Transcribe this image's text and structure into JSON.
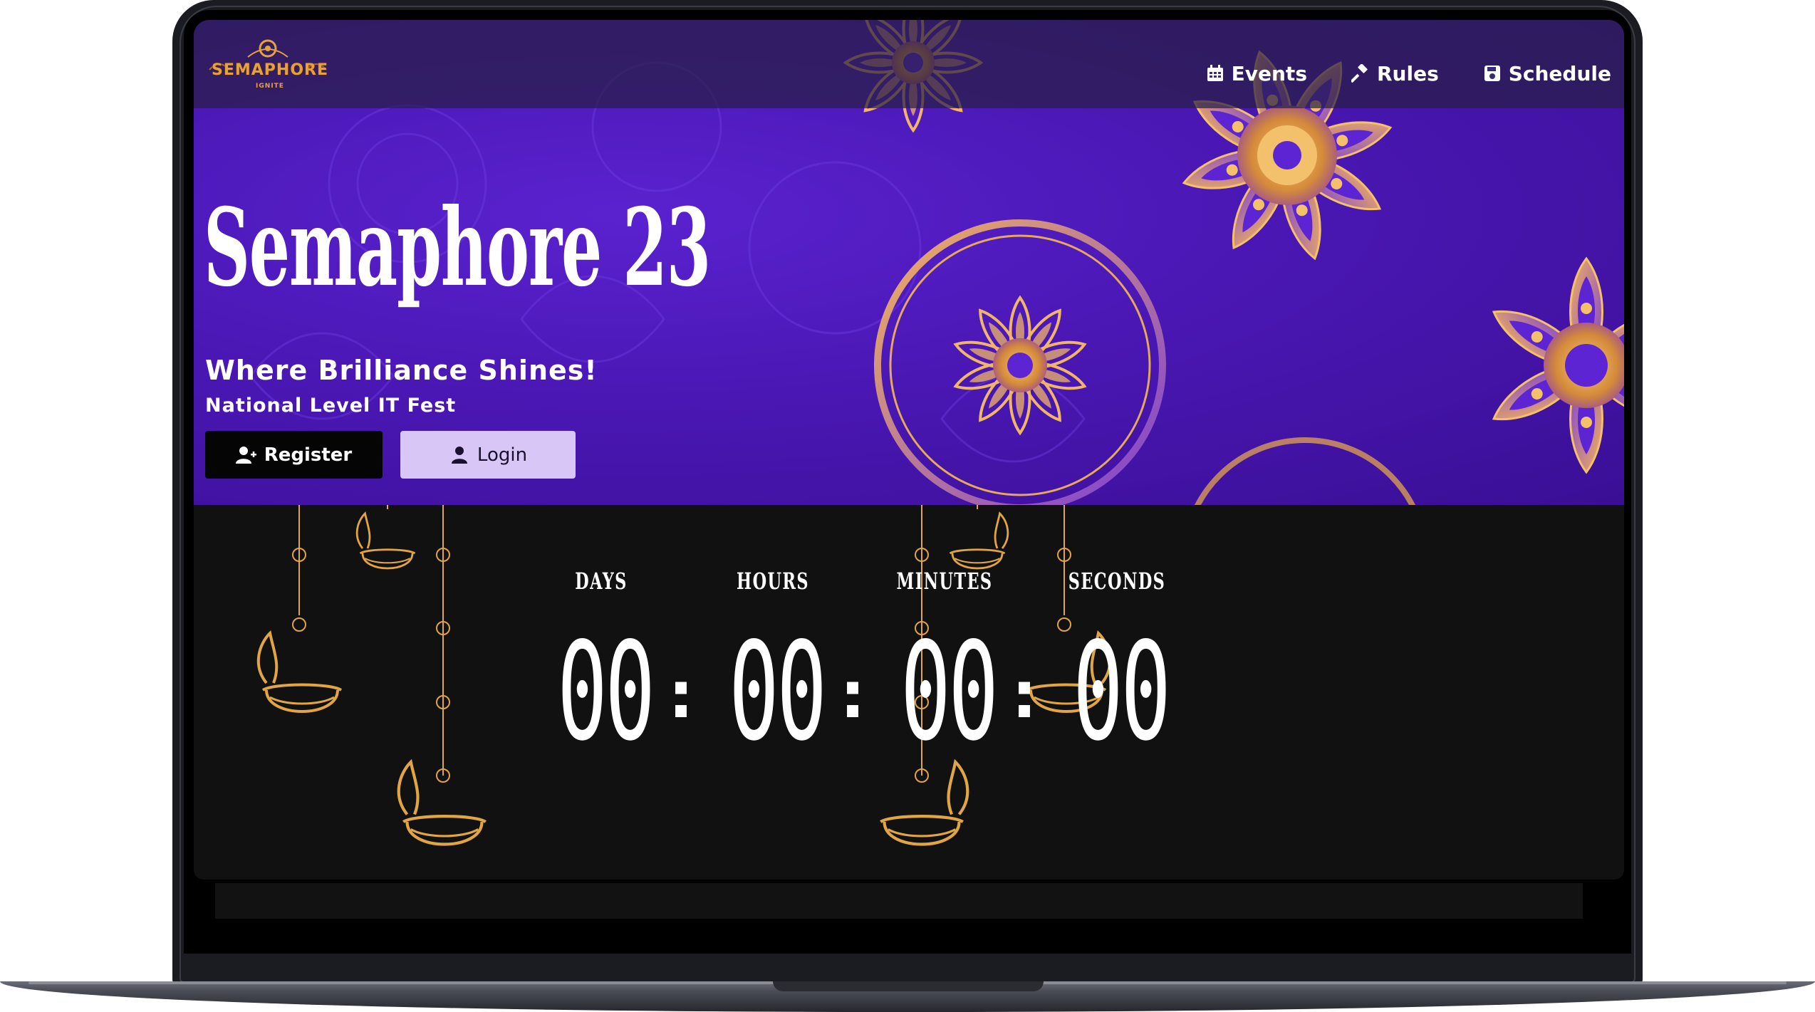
{
  "nav": {
    "logo_text": "SEMAPHORE",
    "logo_sub": "IGNITE",
    "items": [
      {
        "label": "Events",
        "icon": "calendar-icon"
      },
      {
        "label": "Rules",
        "icon": "gavel-icon"
      },
      {
        "label": "Schedule",
        "icon": "save-icon"
      }
    ]
  },
  "hero": {
    "title": "Semaphore 23",
    "subtitle": "Where Brilliance Shines!",
    "tagline": "National Level IT Fest",
    "register_label": "Register",
    "login_label": "Login"
  },
  "countdown": {
    "labels": [
      "DAYS",
      "HOURS",
      "MINUTES",
      "SECONDS"
    ],
    "values": [
      "00",
      "00",
      "00",
      "00"
    ],
    "separator": ":"
  },
  "colors": {
    "hero_purple": "#4a17b4",
    "gold_accent": "#e6a23a",
    "login_button": "#d8c6f6",
    "register_button": "#050505",
    "countdown_bg": "#111111"
  }
}
